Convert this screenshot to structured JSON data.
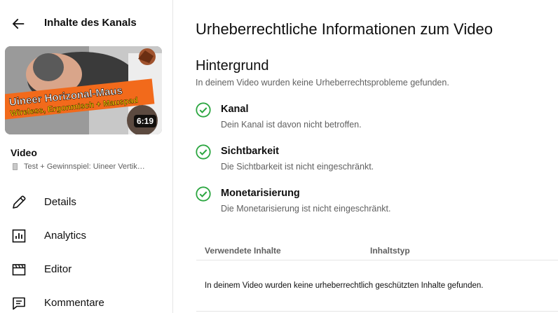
{
  "sidebar": {
    "back_title": "Inhalte des Kanals",
    "thumbnail": {
      "headline_line1": "Uineer Horizonal-Maus",
      "headline_line2": "Wireless, Ergonmisch + Mauspad",
      "duration": "6:19"
    },
    "video_label": "Video",
    "video_title": "Test + Gewinnspiel: Uineer Vertik…",
    "nav": [
      {
        "label": "Details",
        "icon": "pencil-icon"
      },
      {
        "label": "Analytics",
        "icon": "analytics-icon"
      },
      {
        "label": "Editor",
        "icon": "clapperboard-icon"
      },
      {
        "label": "Kommentare",
        "icon": "comment-icon"
      }
    ]
  },
  "main": {
    "title": "Urheberrechtliche Informationen zum Video",
    "section_title": "Hintergrund",
    "section_desc": "In deinem Video wurden keine Urheberrechtsprobleme gefunden.",
    "checks": [
      {
        "title": "Kanal",
        "desc": "Dein Kanal ist davon nicht betroffen."
      },
      {
        "title": "Sichtbarkeit",
        "desc": "Die Sichtbarkeit ist nicht eingeschränkt."
      },
      {
        "title": "Monetarisierung",
        "desc": "Die Monetarisierung ist nicht eingeschränkt."
      }
    ],
    "table": {
      "columns": [
        "Verwendete Inhalte",
        "Inhaltstyp"
      ],
      "empty_text": "In deinem Video wurden keine urheberrechtlich geschützten Inhalte gefunden."
    }
  },
  "colors": {
    "check_green": "#2ba640",
    "thumb_banner_orange": "#f26a1b",
    "thumb_text_yellow": "#ffd400"
  }
}
